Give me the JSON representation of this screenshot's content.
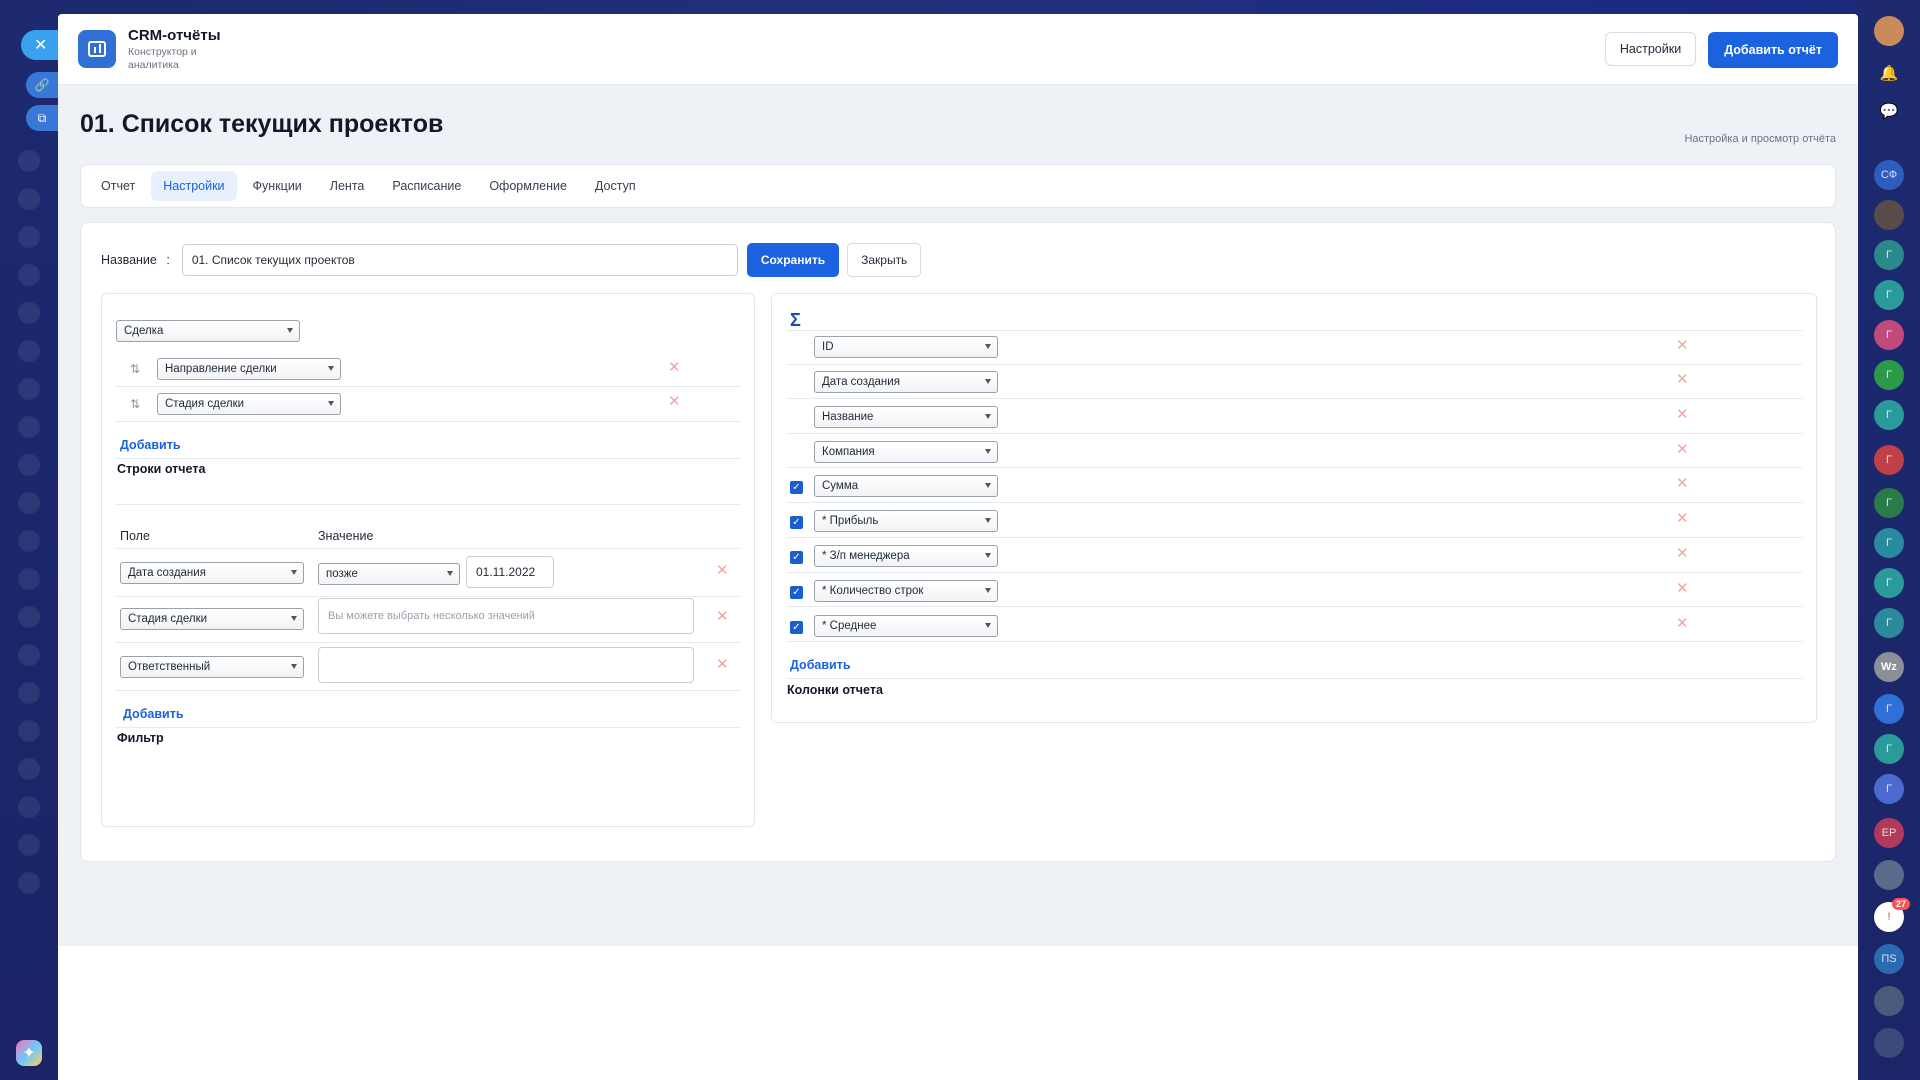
{
  "header": {
    "app_title": "CRM-отчёты",
    "app_subtitle": "Конструктор и аналитика",
    "settings_button": "Настройки",
    "add_report_button": "Добавить отчёт"
  },
  "page": {
    "title": "01. Список текущих проектов",
    "hint": "Настройка и просмотр отчёта"
  },
  "tabs": [
    {
      "label": "Отчет",
      "active": false
    },
    {
      "label": "Настройки",
      "active": true
    },
    {
      "label": "Функции",
      "active": false
    },
    {
      "label": "Лента",
      "active": false
    },
    {
      "label": "Расписание",
      "active": false
    },
    {
      "label": "Оформление",
      "active": false
    },
    {
      "label": "Доступ",
      "active": false
    }
  ],
  "form": {
    "name_label": "Название",
    "name_separator": ":",
    "name_value": "01. Список текущих проектов",
    "save_button": "Сохранить",
    "close_button": "Закрыть"
  },
  "rows_section": {
    "entity_select": "Сделка",
    "groupings": [
      "Направление сделки",
      "Стадия сделки"
    ],
    "add_link": "Добавить",
    "title": "Строки отчета"
  },
  "filter_section": {
    "field_header": "Поле",
    "value_header": "Значение",
    "rows": [
      {
        "field": "Дата создания",
        "operator": "позже",
        "value": "01.11.2022"
      },
      {
        "field": "Стадия сделки",
        "placeholder": "Вы можете выбрать несколько значений"
      },
      {
        "field": "Ответственный",
        "value": ""
      }
    ],
    "add_link": "Добавить",
    "title": "Фильтр"
  },
  "columns_section": {
    "sigma_icon": "Σ",
    "columns": [
      {
        "label": "ID",
        "checked": false,
        "has_checkbox": false
      },
      {
        "label": "Дата создания",
        "checked": false,
        "has_checkbox": false
      },
      {
        "label": "Название",
        "checked": false,
        "has_checkbox": false
      },
      {
        "label": "Компания",
        "checked": false,
        "has_checkbox": false
      },
      {
        "label": "Сумма",
        "checked": true,
        "has_checkbox": true
      },
      {
        "label": "* Прибыль",
        "checked": true,
        "has_checkbox": true
      },
      {
        "label": "* З/п менеджера",
        "checked": true,
        "has_checkbox": true
      },
      {
        "label": "* Количество строк",
        "checked": true,
        "has_checkbox": true
      },
      {
        "label": "* Среднее",
        "checked": true,
        "has_checkbox": true
      }
    ],
    "add_link": "Добавить",
    "title": "Колонки отчета"
  },
  "right_rail": {
    "notification_count": "27",
    "avatars": [
      "СФ",
      "Г",
      "Г",
      "Г",
      "Г",
      "Г",
      "Г",
      "Г",
      "Г",
      "Г",
      "Г",
      "Wz",
      "Г",
      "Г",
      "Г",
      "ЕР",
      "ПS"
    ]
  },
  "colors": {
    "accent": "#1a62e0",
    "background_dark": "#1d2a70",
    "remove_icon": "#f3a5a5"
  }
}
